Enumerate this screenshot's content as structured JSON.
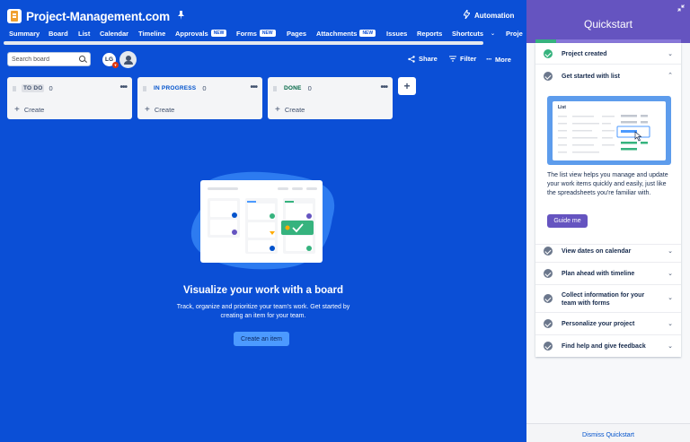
{
  "project": {
    "title": "Project-Management.com"
  },
  "automation_label": "Automation",
  "tabs": [
    {
      "label": "Summary"
    },
    {
      "label": "Board"
    },
    {
      "label": "List"
    },
    {
      "label": "Calendar"
    },
    {
      "label": "Timeline"
    },
    {
      "label": "Approvals",
      "badge": "NEW"
    },
    {
      "label": "Forms",
      "badge": "NEW"
    },
    {
      "label": "Pages"
    },
    {
      "label": "Attachments",
      "badge": "NEW"
    },
    {
      "label": "Issues"
    },
    {
      "label": "Reports"
    },
    {
      "label": "Shortcuts"
    },
    {
      "label": "Proje"
    }
  ],
  "toolbar": {
    "search_placeholder": "Search board",
    "avatar_initials": "LG",
    "share_label": "Share",
    "filter_label": "Filter",
    "more_label": "More"
  },
  "columns": [
    {
      "name": "TO DO",
      "count": "0",
      "create_label": "Create"
    },
    {
      "name": "IN PROGRESS",
      "count": "0",
      "create_label": "Create"
    },
    {
      "name": "DONE",
      "count": "0",
      "create_label": "Create"
    }
  ],
  "empty_state": {
    "title": "Visualize your work with a board",
    "description": "Track, organize and prioritize your team's work. Get started by creating an item for your team.",
    "button_label": "Create an item"
  },
  "quickstart": {
    "title": "Quickstart",
    "progress_percent": 14,
    "items": [
      {
        "label": "Project created",
        "done": true
      },
      {
        "label": "Get started with list",
        "done": false,
        "expanded": true
      },
      {
        "label": "View dates on calendar",
        "done": false
      },
      {
        "label": "Plan ahead with timeline",
        "done": false
      },
      {
        "label": "Collect information for your team with forms",
        "done": false
      },
      {
        "label": "Personalize your project",
        "done": false
      },
      {
        "label": "Find help and give feedback",
        "done": false
      }
    ],
    "illustration_label": "List",
    "description": "The list view helps you manage and update your work items quickly and easily, just like the spreadsheets you're familiar with.",
    "guide_label": "Guide me",
    "dismiss_label": "Dismiss Quickstart"
  },
  "colors": {
    "board_bg": "#0b4fd6",
    "quickstart_header": "#6554c0",
    "done_green": "#36b37e",
    "primary_button": "#4c9aff"
  }
}
